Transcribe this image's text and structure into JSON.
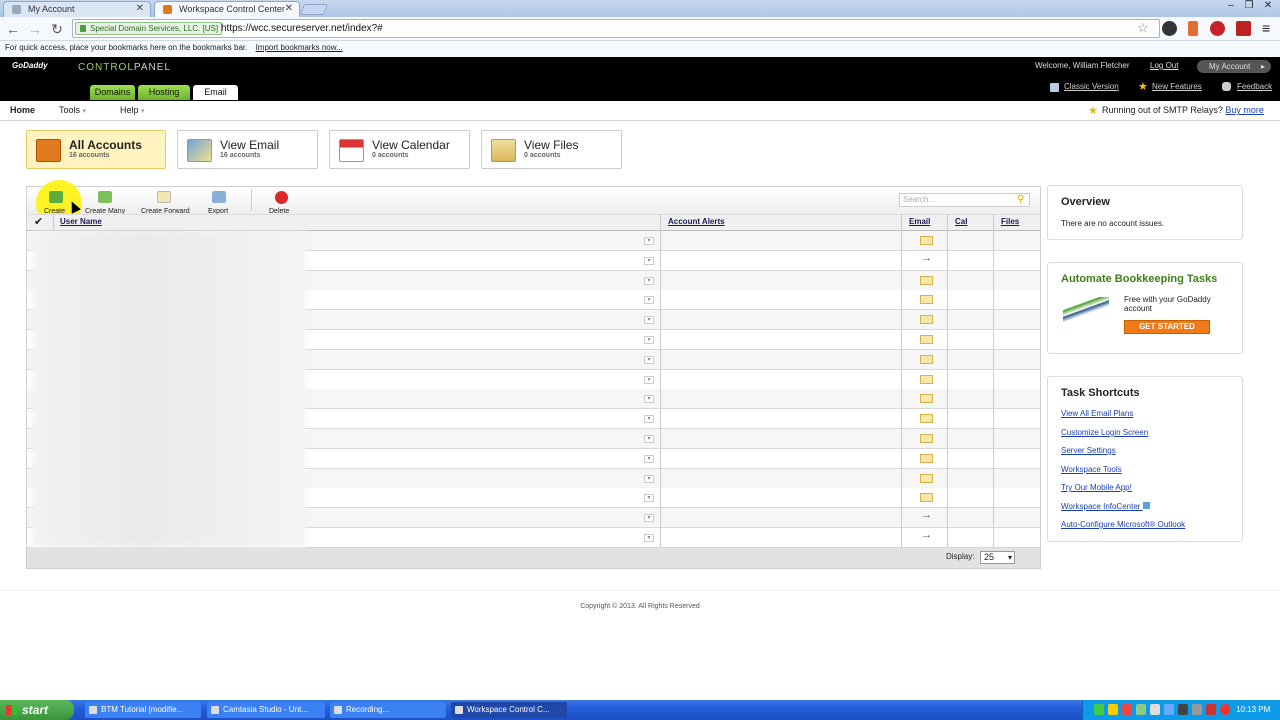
{
  "browser": {
    "tabs": [
      {
        "title": "My Account",
        "active": false
      },
      {
        "title": "Workspace Control Center",
        "active": true
      }
    ],
    "ssl_label": "Special Domain Services, LLC. [US]",
    "url": "https://wcc.secureserver.net/index?#",
    "bookmarks_message": "For quick access, place your bookmarks here on the bookmarks bar.",
    "import_link": "Import bookmarks now..."
  },
  "header": {
    "logo": "GoDaddy",
    "control": "CONTROL",
    "panel": "PANEL",
    "welcome": "Welcome, William Fletcher",
    "logout": "Log Out",
    "my_account": "My Account",
    "tabs": [
      "Domains",
      "Hosting",
      "Email"
    ],
    "links": [
      "Classic Version",
      "New Features",
      "Feedback"
    ]
  },
  "menu": {
    "items": [
      "Home",
      "Tools",
      "Help"
    ],
    "smtp_text": "Running out of SMTP Relays?",
    "smtp_link": "Buy more"
  },
  "cards": [
    {
      "title": "All Accounts",
      "sub": "16 accounts",
      "icon": "workspace-icon"
    },
    {
      "title": "View Email",
      "sub": "16 accounts",
      "icon": "email-icon"
    },
    {
      "title": "View Calendar",
      "sub": "0 accounts",
      "icon": "calendar-icon"
    },
    {
      "title": "View Files",
      "sub": "0 accounts",
      "icon": "files-icon"
    }
  ],
  "toolbar": {
    "create": "Create",
    "create_many": "Create Many",
    "create_forward": "Create Forward",
    "export": "Export",
    "delete": "Delete",
    "search_placeholder": "Search..."
  },
  "table": {
    "columns": [
      "User Name",
      "Account Alerts",
      "Email",
      "Cal",
      "Files"
    ],
    "rows": [
      {
        "email": "envelope"
      },
      {
        "email": "arrow"
      },
      {
        "email": "envelope"
      },
      {
        "email": "envelope"
      },
      {
        "email": "envelope"
      },
      {
        "email": "envelope"
      },
      {
        "email": "envelope"
      },
      {
        "email": "envelope"
      },
      {
        "email": "envelope"
      },
      {
        "email": "envelope"
      },
      {
        "email": "envelope"
      },
      {
        "email": "envelope"
      },
      {
        "email": "envelope"
      },
      {
        "email": "envelope"
      },
      {
        "email": "arrow"
      },
      {
        "email": "arrow"
      }
    ],
    "display_label": "Display:",
    "display_value": "25"
  },
  "overview": {
    "title": "Overview",
    "text": "There are no account issues."
  },
  "bookkeeping": {
    "title": "Automate Bookkeeping Tasks",
    "text": "Free with your GoDaddy account",
    "button": "GET STARTED"
  },
  "shortcuts": {
    "title": "Task Shortcuts",
    "links": [
      "View All Email Plans",
      "Customize Login Screen",
      "Server Settings",
      "Workspace Tools",
      "Try Our Mobile App!",
      "Workspace InfoCenter",
      "Auto-Configure Microsoft® Outlook"
    ]
  },
  "copyright": "Copyright © 2013. All Rights Reserved",
  "taskbar": {
    "start": "start",
    "tasks": [
      "BTM Tutorial [modifie...",
      "Camtasia Studio - Unt...",
      "Recording...",
      "Workspace Control C..."
    ],
    "clock": "10:13 PM"
  },
  "colors": {
    "accent_green": "#6fb42e",
    "link_blue": "#1a3fb0",
    "taskbar_blue": "#245edb"
  }
}
